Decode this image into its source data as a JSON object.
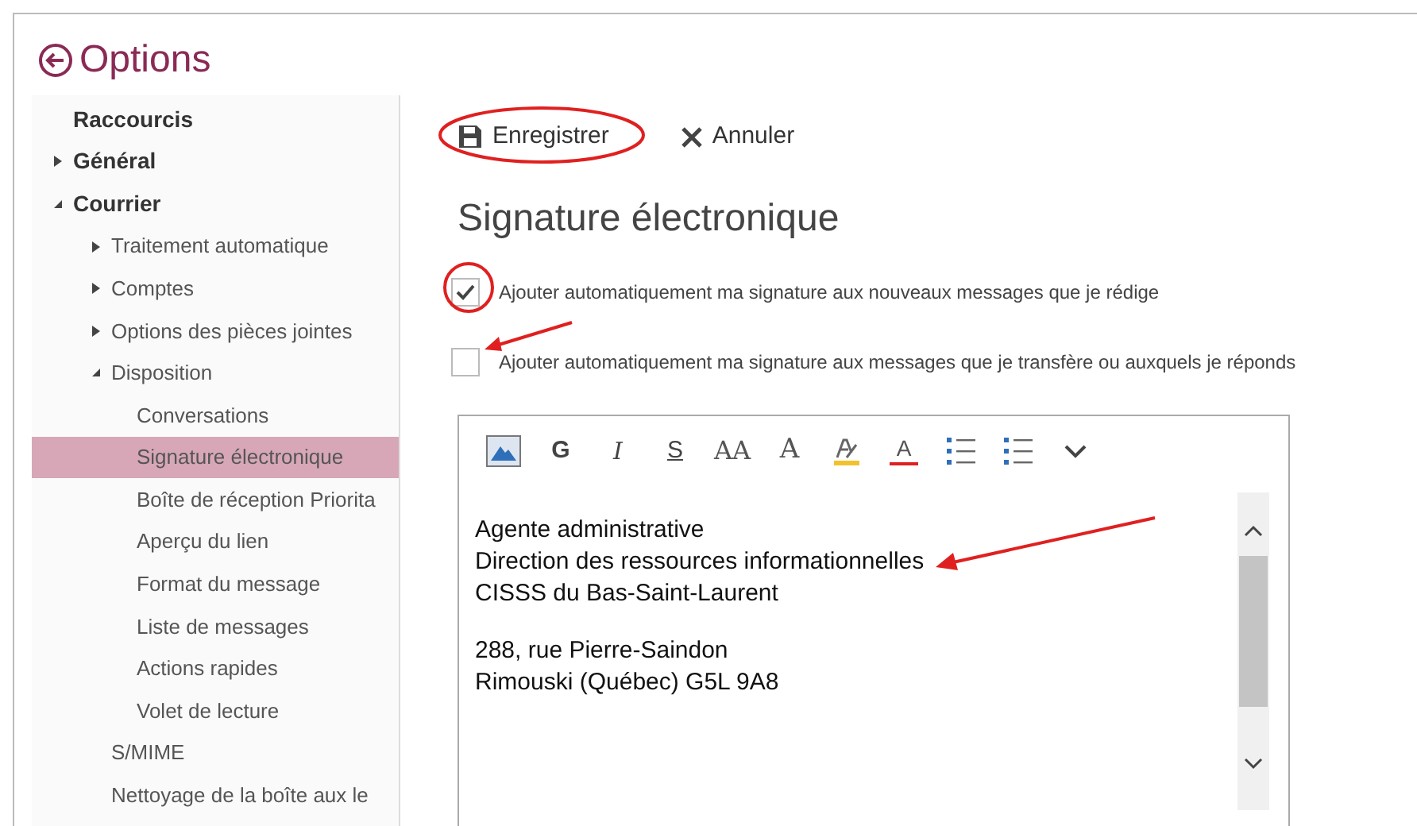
{
  "header": {
    "title": "Options"
  },
  "sidebar": {
    "items": [
      {
        "label": "Raccourcis"
      },
      {
        "label": "Général",
        "expanded": false
      },
      {
        "label": "Courrier",
        "expanded": true,
        "children": [
          {
            "label": "Traitement automatique",
            "expanded": false
          },
          {
            "label": "Comptes",
            "expanded": false
          },
          {
            "label": "Options des pièces jointes",
            "expanded": false
          },
          {
            "label": "Disposition",
            "expanded": true,
            "children": [
              {
                "label": "Conversations",
                "selected": false
              },
              {
                "label": "Signature électronique",
                "selected": true
              },
              {
                "label": "Boîte de réception Priorita",
                "selected": false
              },
              {
                "label": "Aperçu du lien",
                "selected": false
              },
              {
                "label": "Format du message",
                "selected": false
              },
              {
                "label": "Liste de messages",
                "selected": false
              },
              {
                "label": "Actions rapides",
                "selected": false
              },
              {
                "label": "Volet de lecture",
                "selected": false
              }
            ]
          },
          {
            "label": "S/MIME"
          },
          {
            "label": "Nettoyage de la boîte aux le"
          }
        ]
      }
    ]
  },
  "toolbar": [
    {
      "kind": "save",
      "label": "Enregistrer"
    },
    {
      "kind": "cancel",
      "label": "Annuler"
    }
  ],
  "section_title": "Signature électronique",
  "options": [
    {
      "label": "Ajouter automatiquement ma signature aux nouveaux messages que je rédige",
      "checked": true
    },
    {
      "label": "Ajouter automatiquement ma signature aux messages que je transfère ou auxquels je réponds",
      "checked": false
    }
  ],
  "editor": {
    "tools": [
      {
        "kind": "image"
      },
      {
        "kind": "bold",
        "text": "G"
      },
      {
        "kind": "italic",
        "text": "I"
      },
      {
        "kind": "strike",
        "text": "S"
      },
      {
        "kind": "size",
        "text": "AA"
      },
      {
        "kind": "grow",
        "text": "A"
      },
      {
        "kind": "highlight"
      },
      {
        "kind": "color",
        "text": "A"
      },
      {
        "kind": "bullets"
      },
      {
        "kind": "numbers"
      },
      {
        "kind": "more"
      }
    ],
    "paragraphs": [
      [
        "Agente administrative",
        "Direction des ressources informationnelles",
        "CISSS du Bas-Saint-Laurent"
      ],
      [
        "288, rue Pierre-Saindon",
        "Rimouski (Québec) G5L 9A8"
      ]
    ]
  }
}
